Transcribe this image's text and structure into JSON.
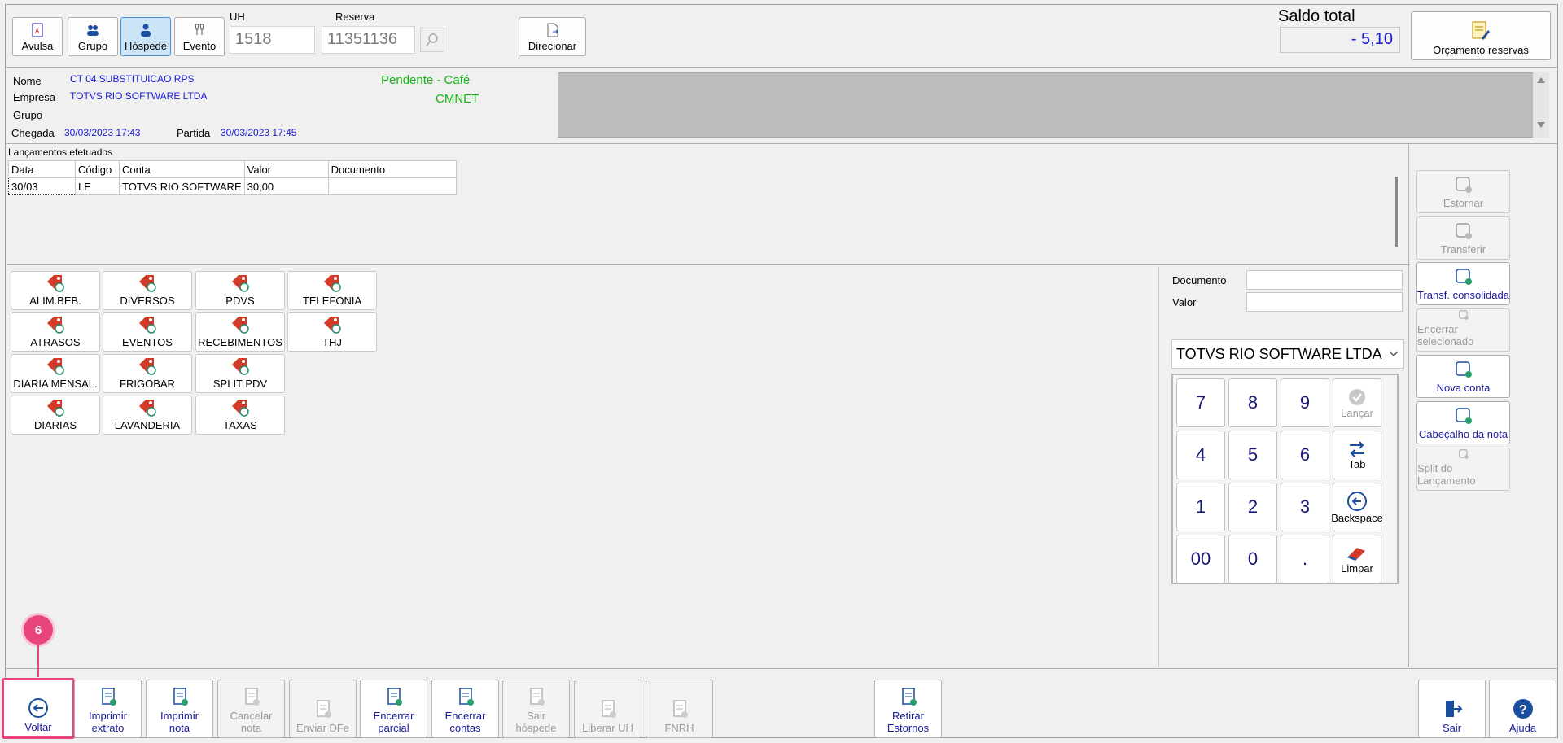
{
  "toolbar": {
    "avulsa": "Avulsa",
    "grupo": "Grupo",
    "hospede": "Hóspede",
    "evento": "Evento",
    "uh_label": "UH",
    "uh_value": "1518",
    "reserva_label": "Reserva",
    "reserva_value": "11351136",
    "direcionar": "Direcionar",
    "saldo_label": "Saldo total",
    "saldo_value": "- 5,10",
    "orcamento": "Orçamento reservas"
  },
  "guest": {
    "nome_label": "Nome",
    "nome_value": "CT 04 SUBSTITUICAO RPS",
    "empresa_label": "Empresa",
    "empresa_value": "TOTVS RIO SOFTWARE LTDA",
    "grupo_label": "Grupo",
    "chegada_label": "Chegada",
    "chegada_value": "30/03/2023 17:43",
    "partida_label": "Partida",
    "partida_value": "30/03/2023 17:45",
    "status_line1": "Pendente -  Café",
    "status_line2": "CMNET"
  },
  "lancamentos": {
    "title": "Lançamentos efetuados",
    "columns": [
      "Data",
      "Código",
      "Conta",
      "Valor",
      "Documento"
    ],
    "row": [
      "30/03",
      "LE",
      "TOTVS RIO SOFTWARE",
      "30,00",
      ""
    ]
  },
  "categories": [
    "ALIM.BEB.",
    "DIVERSOS",
    "PDVS",
    "TELEFONIA",
    "ATRASOS",
    "EVENTOS",
    "RECEBIMENTOS",
    "THJ",
    "DIARIA MENSAL.",
    "FRIGOBAR",
    "SPLIT PDV",
    "DIARIAS",
    "LAVANDERIA",
    "TAXAS"
  ],
  "entry": {
    "documento_label": "Documento",
    "valor_label": "Valor",
    "conta_select": "TOTVS RIO SOFTWARE LTDA"
  },
  "keypad": {
    "k7": "7",
    "k8": "8",
    "k9": "9",
    "lancar": "Lançar",
    "k4": "4",
    "k5": "5",
    "k6": "6",
    "tab": "Tab",
    "k1": "1",
    "k2": "2",
    "k3": "3",
    "backspace": "Backspace",
    "k00": "00",
    "k0": "0",
    "kdot": ".",
    "limpar": "Limpar"
  },
  "side": {
    "estornar": "Estornar",
    "transferir": "Transferir",
    "transf_consolidada": "Transf. consolidada",
    "encerrar_selecionado": "Encerrar selecionado",
    "nova_conta": "Nova conta",
    "cabecalho": "Cabeçalho da nota",
    "split": "Split do Lançamento"
  },
  "bottom": {
    "voltar": "Voltar",
    "imprimir_extrato_1": "Imprimir",
    "imprimir_extrato_2": "extrato",
    "imprimir_nota_1": "Imprimir",
    "imprimir_nota_2": "nota",
    "cancelar_nota_1": "Cancelar",
    "cancelar_nota_2": "nota",
    "enviar_dfe": "Enviar DFe",
    "encerrar_parcial_1": "Encerrar",
    "encerrar_parcial_2": "parcial",
    "encerrar_contas_1": "Encerrar",
    "encerrar_contas_2": "contas",
    "sair_hospede_1": "Sair",
    "sair_hospede_2": "hóspede",
    "liberar_uh": "Liberar UH",
    "fnrh": "FNRH",
    "retirar_estornos_1": "Retirar",
    "retirar_estornos_2": "Estornos",
    "sair": "Sair",
    "ajuda": "Ajuda"
  },
  "step_badge": "6",
  "colors": {
    "accent": "#1a1a9c",
    "highlight": "#e8457a",
    "pending": "#17b417"
  }
}
